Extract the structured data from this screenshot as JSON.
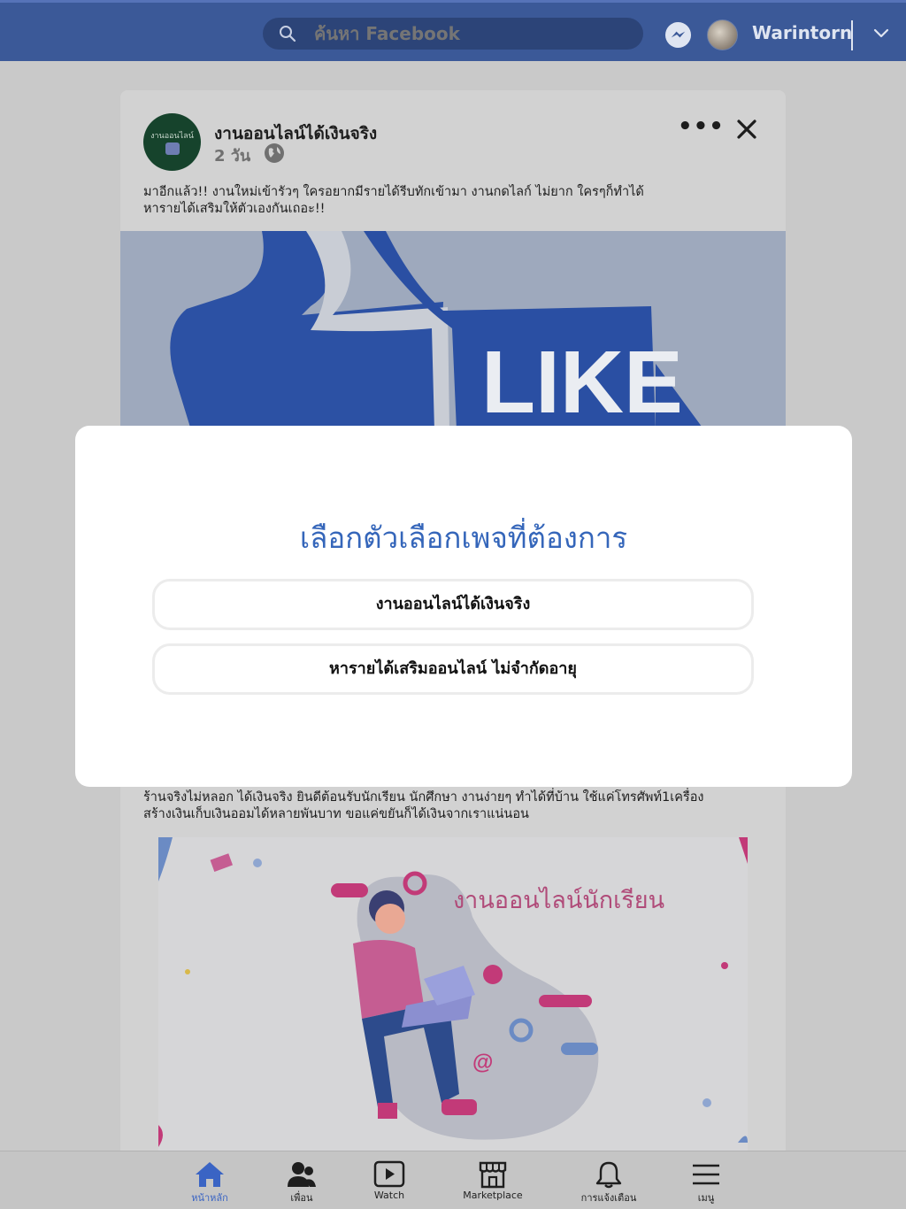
{
  "topbar": {
    "search_placeholder": "ค้นหา Facebook",
    "username": "Warintorn",
    "icons": [
      "search-icon",
      "messenger-icon",
      "chevron-down-icon"
    ]
  },
  "post": {
    "page_name": "งานออนไลน์ได้เงินจริง",
    "avatar_text": "งานออนไลน์",
    "time": "2 วัน",
    "text_line1": "มาอีกแล้ว!! งานใหม่เข้ารัวๆ ใครอยากมีรายได้รีบทักเข้ามา งานกดไลก์ ไม่ยาก ใครๆก็ทำได้",
    "text_line2": "หารายได้เสริมให้ตัวเองกันเถอะ!!",
    "image_text": "LIKE",
    "text2_line1": "ร้านจริงไม่หลอก ได้เงินจริง ยินดีต้อนรับนักเรียน นักศึกษา งานง่ายๆ ทำได้ที่บ้าน ใช้แค่โทรศัพท์1เครื่อง",
    "text2_line2": "สร้างเงินเก็บเงินออมได้หลายพันบาท ขอแค่ขยันก็ได้เงินจากเราแน่นอน",
    "promo_title": "งานออนไลน์นักเรียน"
  },
  "modal": {
    "title": "เลือกตัวเลือกเพจที่ต้องการ",
    "options": [
      "งานออนไลน์ได้เงินจริง",
      "หารายได้เสริมออนไลน์ ไม่จำกัดอายุ"
    ]
  },
  "bottom_nav": {
    "items": [
      {
        "label": "หน้าหลัก",
        "icon": "home-icon",
        "active": true
      },
      {
        "label": "เพื่อน",
        "icon": "friends-icon"
      },
      {
        "label": "Watch",
        "icon": "watch-icon"
      },
      {
        "label": "Marketplace",
        "icon": "marketplace-icon"
      },
      {
        "label": "การแจ้งเตือน",
        "icon": "bell-icon"
      },
      {
        "label": "เมนู",
        "icon": "menu-icon"
      }
    ]
  },
  "colors": {
    "topbar": "#3b5998",
    "modal_title": "#3566ba",
    "active_nav": "#3a64c4",
    "promo_title": "#b04b79"
  }
}
